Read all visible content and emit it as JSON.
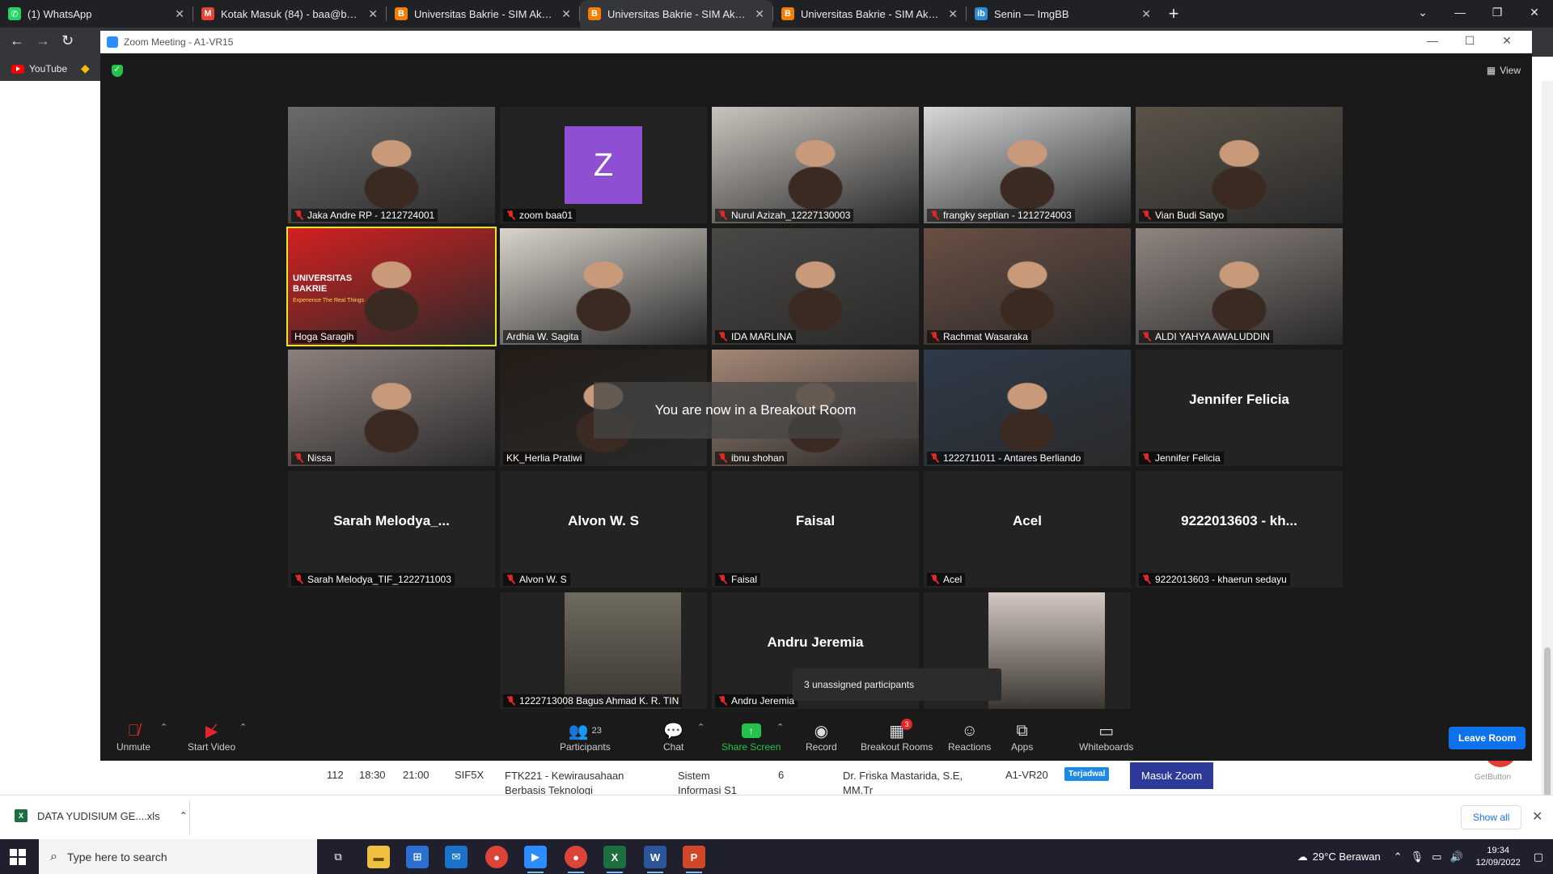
{
  "browser": {
    "tabs": [
      {
        "title": "(1) WhatsApp",
        "icon": "whatsapp-icon",
        "color": "#25d366",
        "glyph": "✆"
      },
      {
        "title": "Kotak Masuk (84) - baa@bakrie.ac.id",
        "icon": "gmail-icon",
        "color": "#ea4335",
        "glyph": "M"
      },
      {
        "title": "Universitas Bakrie - SIM Akademik",
        "icon": "blogger-icon",
        "color": "#f57d00",
        "glyph": "B"
      },
      {
        "title": "Universitas Bakrie - SIM Akademik",
        "icon": "blogger-icon",
        "color": "#f57d00",
        "glyph": "B",
        "active": true
      },
      {
        "title": "Universitas Bakrie - SIM Akademik",
        "icon": "blogger-icon",
        "color": "#f57d00",
        "glyph": "B"
      },
      {
        "title": "Senin — ImgBB",
        "icon": "imgbb-icon",
        "color": "#2a8bd6",
        "glyph": "ib"
      }
    ],
    "bookmark": "YouTube"
  },
  "zoom": {
    "window_title": "Zoom Meeting - A1-VR15",
    "view_label": "View",
    "participants": [
      {
        "name": "Jaka Andre RP - 1212724001",
        "muted": true,
        "video": true,
        "bg": "#6b6b6b"
      },
      {
        "name": "zoom baa01",
        "muted": true,
        "avatar": "Z"
      },
      {
        "name": "Nurul Azizah_12227130003",
        "muted": true,
        "video": true,
        "bg": "#c9c4bd"
      },
      {
        "name": "frangky septian - 1212724003",
        "muted": true,
        "video": true,
        "bg": "#d7d8da"
      },
      {
        "name": "Vian Budi Satyo",
        "muted": true,
        "video": true,
        "bg": "#5b5349"
      },
      {
        "name": "Hoga Saragih",
        "muted": false,
        "video": true,
        "bg": "#d32020",
        "speaking": true,
        "banner": "UNIVERSITAS BAKRIE",
        "banner_sub": "Experience The Real Things"
      },
      {
        "name": "Ardhia W. Sagita",
        "muted": false,
        "video": true,
        "bg": "#d9d4cc"
      },
      {
        "name": "IDA MARLINA",
        "muted": true,
        "video": true,
        "bg": "#4a4845"
      },
      {
        "name": "Rachmat Wasaraka",
        "muted": true,
        "video": true,
        "bg": "#6a4f43"
      },
      {
        "name": "ALDI YAHYA AWALUDDIN",
        "muted": true,
        "video": true,
        "bg": "#8f8580"
      },
      {
        "name": "Nissa",
        "muted": true,
        "video": true,
        "bg": "#8d807c"
      },
      {
        "name": "KK_Herlia Pratiwi",
        "muted": false,
        "video": true,
        "bg": "#241c17"
      },
      {
        "name": "ibnu shohan",
        "muted": true,
        "video": true,
        "bg": "#a38776"
      },
      {
        "name": "1222711011 - Antares Berliando",
        "muted": true,
        "video": true,
        "bg": "#2f3a4a"
      },
      {
        "name": "Jennifer Felicia",
        "muted": true,
        "display": "Jennifer Felicia"
      },
      {
        "name": "Sarah Melodya_TIF_1222711003",
        "muted": true,
        "display": "Sarah  Melodya_..."
      },
      {
        "name": "Alvon W. S",
        "muted": true,
        "display": "Alvon W. S"
      },
      {
        "name": "Faisal",
        "muted": true,
        "display": "Faisal"
      },
      {
        "name": "Acel",
        "muted": true,
        "display": "Acel"
      },
      {
        "name": "9222013603 - khaerun sedayu",
        "muted": true,
        "display": "9222013603 - kh..."
      },
      {
        "name": "1222713008 Bagus Ahmad K. R. TIN",
        "muted": true,
        "photo": true,
        "bg": "#6f6a5e"
      },
      {
        "name": "Andru Jeremia",
        "muted": true,
        "display": "Andru Jeremia"
      },
      {
        "name": "",
        "muted": false,
        "photo": true,
        "bg": "#d4c9c2"
      }
    ],
    "toast": "You are now in a Breakout Room",
    "unassigned": "3 unassigned participants",
    "toolbar": {
      "unmute": "Unmute",
      "start_video": "Start Video",
      "participants": "Participants",
      "participants_count": "23",
      "chat": "Chat",
      "share": "Share Screen",
      "record": "Record",
      "breakout": "Breakout Rooms",
      "breakout_badge": "3",
      "reactions": "Reactions",
      "apps": "Apps",
      "whiteboards": "Whiteboards",
      "leave": "Leave Room"
    }
  },
  "background_page": {
    "row": [
      "112",
      "18:30",
      "21:00",
      "SIF5X",
      "FTK221 - Kewirausahaan Berbasis Teknologi",
      "Sistem Informasi S1",
      "6",
      "Dr. Friska Mastarida, S.E, MM.Tr",
      "A1-VR20"
    ],
    "badge": "Terjadwal",
    "button": "Masuk Zoom",
    "getbutton": "GetButton"
  },
  "download": {
    "file": "DATA YUDISIUM GE....xls",
    "show_all": "Show all"
  },
  "taskbar": {
    "search_placeholder": "Type here to search",
    "weather": "29°C  Berawan",
    "time": "19:34",
    "date": "12/09/2022"
  }
}
